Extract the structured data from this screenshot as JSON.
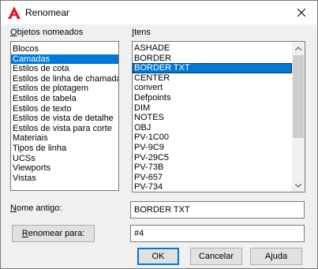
{
  "window": {
    "title": "Renomear",
    "icon": "autocad-logo-icon",
    "close_icon": "close-icon"
  },
  "left_list": {
    "label_hotkey": "O",
    "label_rest": "bjetos nomeados",
    "items": [
      "Blocos",
      "Camadas",
      "Estilos de cota",
      "Estilos de linha de chamada",
      "Estilos de plotagem",
      "Estilos de tabela",
      "Estilos de texto",
      "Estilos de vista de detalhe",
      "Estilos de vista para corte",
      "Materiais",
      "Tipos de linha",
      "UCSs",
      "Viewports",
      "Vistas"
    ],
    "selected": "Camadas"
  },
  "right_list": {
    "label_hotkey": "I",
    "label_rest": "tens",
    "items": [
      "ASHADE",
      "BORDER",
      "BORDER TXT",
      "CENTER",
      "convert",
      "Defpoints",
      "DIM",
      "NOTES",
      "OBJ",
      "PV-1C00",
      "PV-9C9",
      "PV-29C5",
      "PV-73B",
      "PV-657",
      "PV-734"
    ],
    "selected": "BORDER TXT"
  },
  "old_name": {
    "label_hotkey": "N",
    "label_rest": "ome antigo:",
    "value": "BORDER TXT"
  },
  "rename_to": {
    "button_hotkey": "R",
    "button_rest": "enomear para:",
    "value": "#4"
  },
  "buttons": {
    "ok": "OK",
    "cancel": "Cancelar",
    "help_before": "A",
    "help_hotkey": "j",
    "help_after": "uda"
  },
  "colors": {
    "selection": "#0078d7",
    "accent_logo": "#e21b22"
  }
}
